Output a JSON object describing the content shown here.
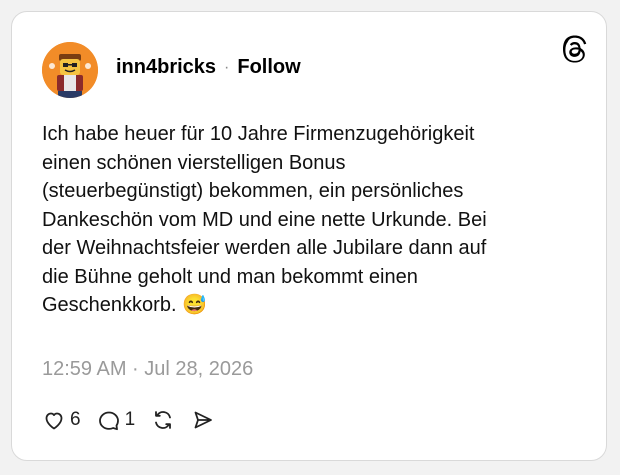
{
  "post": {
    "username": "inn4bricks",
    "separator": "·",
    "follow_label": "Follow",
    "text": "Ich habe heuer für 10 Jahre Firmenzugehörigkeit\neinen schönen vierstelligen Bonus\n(steuerbegünstigt) bekommen, ein persönliches\nDankeschön vom MD und eine nette Urkunde. Bei\nder Weihnachtsfeier werden alle Jubilare dann auf\ndie Bühne geholt und man bekommt einen\nGeschenkkorb. 😅",
    "timestamp": "12:59 AM · Jul 28, 2026"
  },
  "actions": {
    "like_count": "6",
    "reply_count": "1"
  },
  "icons": {
    "avatar": "lego-minifigure-avatar",
    "logo": "threads-logo-icon",
    "like": "heart-icon",
    "reply": "comment-bubble-icon",
    "repost": "repost-icon",
    "share": "send-icon"
  },
  "colors": {
    "avatar_bg": "#f28c28",
    "muted_text": "#9a9a9a"
  }
}
